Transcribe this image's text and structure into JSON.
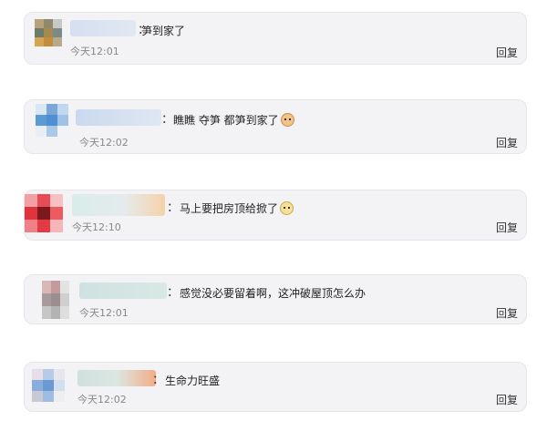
{
  "comments": [
    {
      "separator": "：",
      "text": "笋到家了",
      "time": "今天12:01",
      "reply": "回复"
    },
    {
      "separator": "：",
      "text": "瞧瞧 夺笋 都笋到家了",
      "emoji": "cat-face-emoji",
      "time": "今天12:02",
      "reply": "回复"
    },
    {
      "separator": "：",
      "text": "马上要把房顶给掀了",
      "emoji": "dog-face-emoji",
      "time": "今天12:10",
      "reply": "回复"
    },
    {
      "separator": "：",
      "text": "感觉没必要留着啊，这冲破屋顶怎么办",
      "time": "今天12:01",
      "reply": "回复"
    },
    {
      "separator": "：",
      "text": "生命力旺盛",
      "time": "今天12:02",
      "reply": "回复"
    }
  ]
}
